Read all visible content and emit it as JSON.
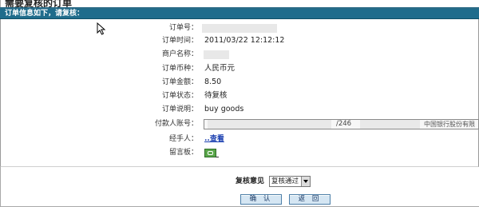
{
  "page": {
    "title": "需要复核的订单",
    "banner": "订单信息如下，请复核："
  },
  "fields": [
    {
      "key": "order_no",
      "label": "订单号：",
      "value": ""
    },
    {
      "key": "order_time",
      "label": "订单时间：",
      "value": "2011/03/22 12:12:12"
    },
    {
      "key": "merchant",
      "label": "商户名称：",
      "value": ""
    },
    {
      "key": "currency",
      "label": "订单币种：",
      "value": "人民币元"
    },
    {
      "key": "amount",
      "label": "订单金额：",
      "value": "8.50"
    },
    {
      "key": "status",
      "label": "订单状态：",
      "value": "待复核"
    },
    {
      "key": "desc",
      "label": "订单说明：",
      "value": "buy goods"
    }
  ],
  "payer": {
    "label": "付款人账号：",
    "account_fragment": "/246",
    "bank": "中国银行股份有限"
  },
  "handler": {
    "label": "经手人：",
    "link": "..查看"
  },
  "note": {
    "label": "留言板："
  },
  "review": {
    "label": "复核意见",
    "selected": "复核通过"
  },
  "buttons": {
    "confirm": "确 认",
    "back": "返 回"
  },
  "colors": {
    "banner": "#1f6c8c",
    "button_bg": "#d5e6f3",
    "link": "#1a3fb0"
  }
}
